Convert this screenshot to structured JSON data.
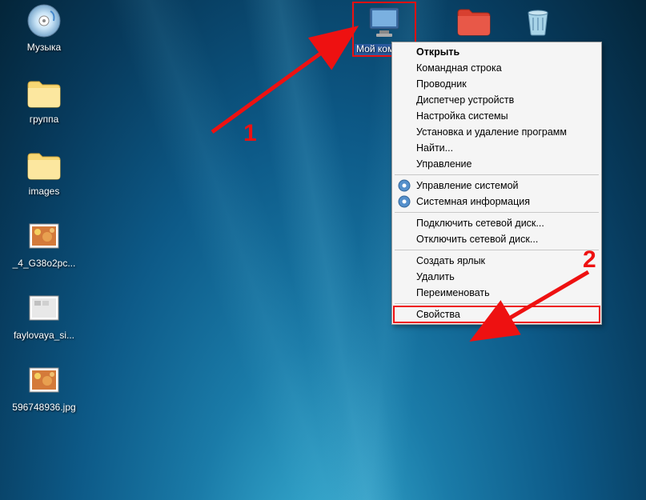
{
  "desktop": {
    "icons": {
      "music": {
        "label": "Музыка"
      },
      "group": {
        "label": "группа"
      },
      "images": {
        "label": "images"
      },
      "img1": {
        "label": "_4_G38o2pс..."
      },
      "img2": {
        "label": "faylovaya_si..."
      },
      "img3": {
        "label": "596748936.jpg"
      },
      "mycomputer": {
        "label": "Мой компь..."
      },
      "redfolder": {
        "label": ""
      },
      "recycle": {
        "label": ""
      }
    }
  },
  "context_menu": {
    "open": "Открыть",
    "cmd": "Командная строка",
    "explorer": "Проводник",
    "devmgr": "Диспетчер устройств",
    "msconfig": "Настройка системы",
    "appwiz": "Установка и удаление программ",
    "find": "Найти...",
    "manage": "Управление",
    "sysmgmt": "Управление системой",
    "sysinfo": "Системная информация",
    "mapdrive": "Подключить сетевой диск...",
    "unmapdrive": "Отключить сетевой диск...",
    "shortcut": "Создать ярлык",
    "delete": "Удалить",
    "rename": "Переименовать",
    "properties": "Свойства"
  },
  "annotations": {
    "one": "1",
    "two": "2"
  }
}
